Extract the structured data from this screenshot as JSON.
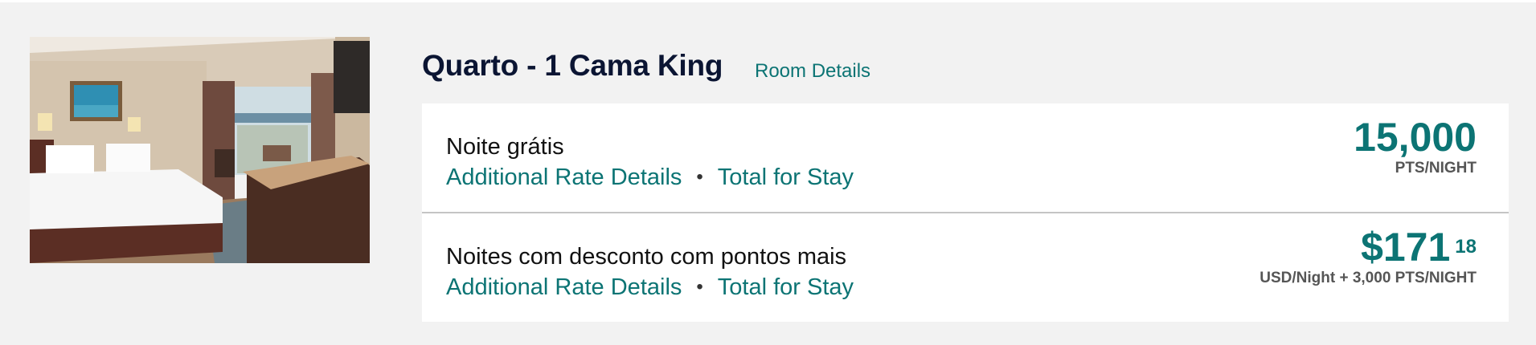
{
  "room": {
    "title": "Quarto - 1 Cama King",
    "details_link": "Room Details",
    "photo_alt": "hotel-room-photo"
  },
  "rates": [
    {
      "name": "Noite grátis",
      "link_details": "Additional Rate Details",
      "separator": "•",
      "link_total": "Total for Stay",
      "price_main": "15,000",
      "price_cents": "",
      "price_unit": "PTS/NIGHT"
    },
    {
      "name": "Noites com desconto com pontos mais",
      "link_details": "Additional Rate Details",
      "separator": "•",
      "link_total": "Total for Stay",
      "price_main": "$171",
      "price_cents": "18",
      "price_unit": "USD/Night + 3,000 PTS/NIGHT"
    }
  ],
  "colors": {
    "accent": "#0c7474",
    "title": "#0b1533",
    "background": "#f2f2f2"
  }
}
